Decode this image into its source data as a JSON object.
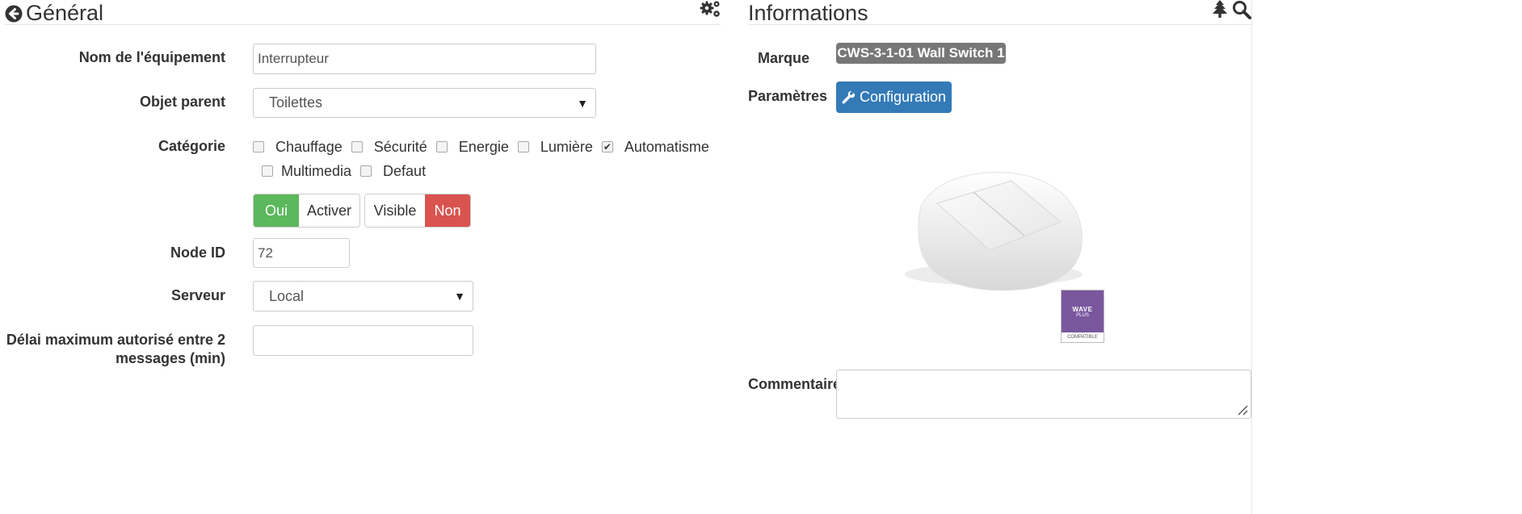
{
  "general": {
    "title": "Général",
    "equipment_name_label": "Nom de l'équipement",
    "equipment_name_value": "Interrupteur",
    "parent_label": "Objet parent",
    "parent_value": "Toilettes",
    "category_label": "Catégorie",
    "categories": [
      {
        "label": "Chauffage",
        "checked": false
      },
      {
        "label": "Sécurité",
        "checked": false
      },
      {
        "label": "Energie",
        "checked": false
      },
      {
        "label": "Lumière",
        "checked": false
      },
      {
        "label": "Automatisme",
        "checked": true
      },
      {
        "label": "Multimedia",
        "checked": false
      },
      {
        "label": "Defaut",
        "checked": false
      }
    ],
    "enable_toggle": {
      "on_label": "Oui",
      "off_label": "Activer",
      "on_color": "#5cb85c"
    },
    "visible_toggle": {
      "on_label": "Visible",
      "off_label": "Non",
      "off_color": "#d9534f"
    },
    "node_id_label": "Node ID",
    "node_id_value": "72",
    "server_label": "Serveur",
    "server_value": "Local",
    "delay_label_line1": "Délai maximum autorisé entre 2",
    "delay_label_line2": "messages (min)",
    "delay_value": ""
  },
  "info": {
    "title": "Informations",
    "brand_label": "Marque",
    "brand_value": "CWS-3-1-01 Wall Switch 1",
    "params_label": "Paramètres",
    "config_button": "Configuration",
    "zwave_logo_line1": "WAVE",
    "zwave_logo_line2": "PLUS",
    "zwave_logo_footer": "COMPATIBLE",
    "comment_label": "Commentaire",
    "comment_value": ""
  },
  "icons": [
    "circle-arrow-left-icon",
    "cogs-icon",
    "tree-icon",
    "search-icon",
    "wrench-icon"
  ],
  "colors": {
    "primary": "#337ab7",
    "success": "#5cb85c",
    "danger": "#d9534f",
    "badge": "#777777",
    "zwave": "#7a579d"
  }
}
